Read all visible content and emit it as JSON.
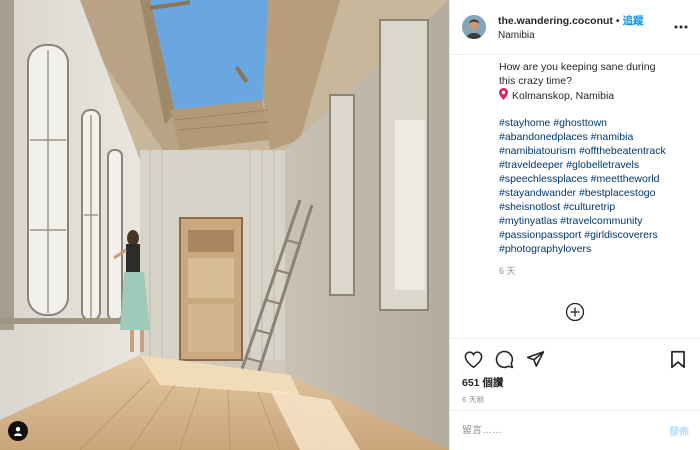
{
  "header": {
    "username": "the.wandering.coconut",
    "separator": "•",
    "follow_label": "追蹤",
    "location": "Namibia",
    "more_icon": "more-horizontal-icon"
  },
  "caption": {
    "question": "How are you keeping sane during\nthis crazy time?",
    "location_pin": "📍",
    "location_text": "Kolmanskop, Namibia",
    "hashtag_lines": [
      [
        "#stayhome",
        "#ghosttown"
      ],
      [
        "#abandonedplaces",
        "#namibia"
      ],
      [
        "#namibiatourism",
        "#offthebeatentrack"
      ],
      [
        "#traveldeeper",
        "#globelletravels"
      ],
      [
        "#speechlessplaces",
        "#meettheworld"
      ],
      [
        "#stayandwander",
        "#bestplacestogo"
      ],
      [
        "#sheisnotlost",
        "#culturetrip"
      ],
      [
        "#mytinyatlas",
        "#travelcommunity"
      ],
      [
        "#passionpassport",
        "#girldiscoverers"
      ],
      [
        "#photographylovers"
      ]
    ],
    "time_ago": "6 天"
  },
  "actions": {
    "like_icon": "heart-icon",
    "comment_icon": "comment-icon",
    "share_icon": "share-icon",
    "save_icon": "bookmark-icon",
    "likes_text": "651 個讚",
    "post_time": "6 天前"
  },
  "comment": {
    "placeholder": "留言……",
    "post_label": "發佈"
  },
  "colors": {
    "link_blue": "#0095f6",
    "hashtag_blue": "#00376b",
    "muted_gray": "#8e8e8e",
    "disabled_post": "#b2dffc"
  }
}
